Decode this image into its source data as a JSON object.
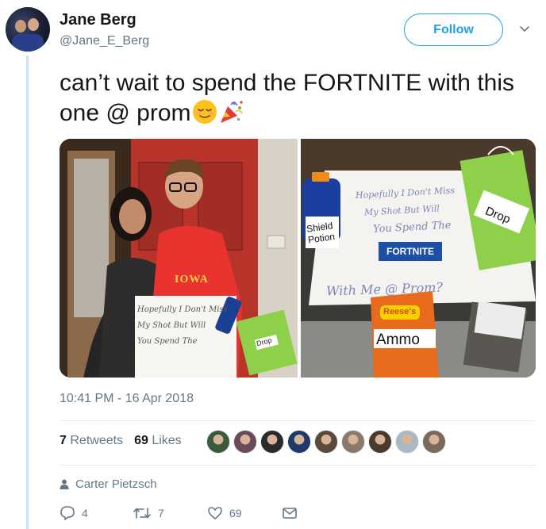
{
  "author": {
    "name": "Jane Berg",
    "handle": "@Jane_E_Berg"
  },
  "follow_label": "Follow",
  "tweet": {
    "text": "can’t wait to spend the FORTNITE with this one @ prom",
    "emojis": [
      "relieved-face-emoji",
      "party-popper-emoji"
    ]
  },
  "photo_right_text": {
    "sign_line1": "Hopefully I Don't Miss",
    "sign_line2": "My Shot But Will",
    "sign_line3": "You Spend The",
    "fortnite_label": "FORTNITE",
    "sign_line4": "With Me @ Prom?",
    "shield_label": "Shield Potion",
    "drop_label": "Drop",
    "ammo_label": "Ammo",
    "candy_label": "Reese's"
  },
  "photo_left_text": {
    "sign_line1": "Hopefully I Don't Miss",
    "sign_line2": "My Shot But Will",
    "sign_line3": "You Spend The",
    "drop_label": "Drop",
    "shirt_label": "IOWA"
  },
  "timestamp": "10:41 PM - 16 Apr 2018",
  "stats": {
    "retweets_count": "7",
    "retweets_label": "Retweets",
    "likes_count": "69",
    "likes_label": "Likes"
  },
  "likers_colors": [
    "#3a5a3a",
    "#6a4a5a",
    "#2a2a2a",
    "#1e3a6a",
    "#5a4a3a",
    "#8a7a6a",
    "#4a3a2a",
    "#aab8c2",
    "#7a6a5a"
  ],
  "reply_to": "Carter Pietzsch",
  "actions": {
    "reply_count": "4",
    "retweet_count": "7",
    "like_count": "69"
  },
  "colors": {
    "accent": "#1da1f2",
    "muted": "#657786",
    "thread": "#c6e4f7"
  }
}
